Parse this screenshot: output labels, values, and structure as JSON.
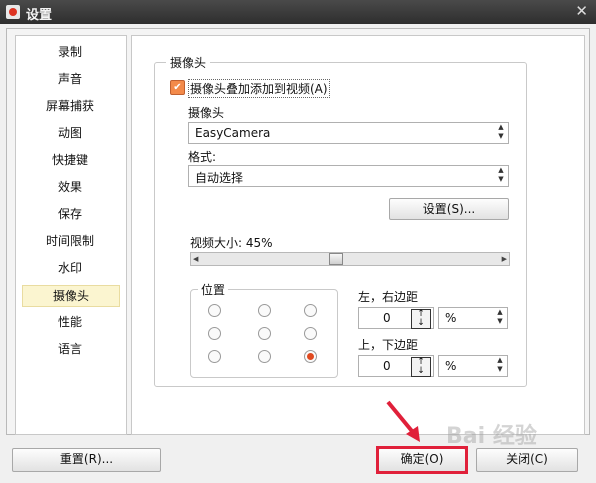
{
  "window": {
    "title": "设置",
    "close_glyph": "✕"
  },
  "sidebar": {
    "items": [
      "录制",
      "声音",
      "屏幕捕获",
      "动图",
      "快捷键",
      "效果",
      "保存",
      "时间限制",
      "水印",
      "摄像头",
      "性能",
      "语言"
    ],
    "active_index": 9
  },
  "camera_group": {
    "title": "摄像头",
    "overlay_checkbox_label": "摄像头叠加添加到视频(A)",
    "overlay_checked": true,
    "camera_label": "摄像头",
    "camera_value": "EasyCamera",
    "format_label": "格式:",
    "format_value": "自动选择",
    "settings_button": "设置(S)...",
    "size_label": "视频大小: 45%",
    "size_value_percent": 45,
    "position_title": "位置",
    "selected_position": "bottom-right",
    "lr_margin_label": "左，右边距",
    "lr_margin_value": "0",
    "lr_unit": "%",
    "tb_margin_label": "上，下边距",
    "tb_margin_value": "0",
    "tb_unit": "%"
  },
  "footer": {
    "reset_button": "重置(R)...",
    "ok_button": "确定(O)",
    "close_button": "关闭(C)"
  },
  "watermark": "Bai 经验",
  "colors": {
    "highlight_red": "#e0203a",
    "check_orange": "#f38a4a",
    "active_nav": "#fbf5d0"
  }
}
